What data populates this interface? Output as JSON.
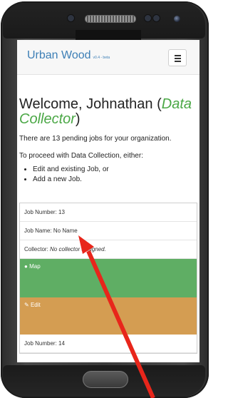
{
  "app": {
    "brand": "Urban Wood",
    "version": "v0.4 - beta"
  },
  "welcome": {
    "prefix": "Welcome, Johnathan (",
    "role": "Data Collector",
    "suffix": ")"
  },
  "pending_text": "There are 13 pending jobs for your organization.",
  "instructions": {
    "lead": "To proceed with Data Collection, either:",
    "options": [
      "Edit and existing Job, or",
      "Add a new Job."
    ]
  },
  "jobs": [
    {
      "number_label": "Job Number: 13",
      "name_label": "Job Name: No Name",
      "collector_prefix": "Collector:",
      "collector_value": "No collector assigned.",
      "map_label": "Map",
      "edit_label": "Edit"
    },
    {
      "number_label": "Job Number: 14"
    }
  ],
  "colors": {
    "brand": "#3d7fb6",
    "role": "#4aa745",
    "map_button": "#5fae64",
    "edit_button": "#d49d52",
    "arrow": "#e8261b"
  },
  "icons": {
    "menu": "hamburger-icon",
    "map": "globe-icon",
    "edit": "pencil-icon"
  }
}
